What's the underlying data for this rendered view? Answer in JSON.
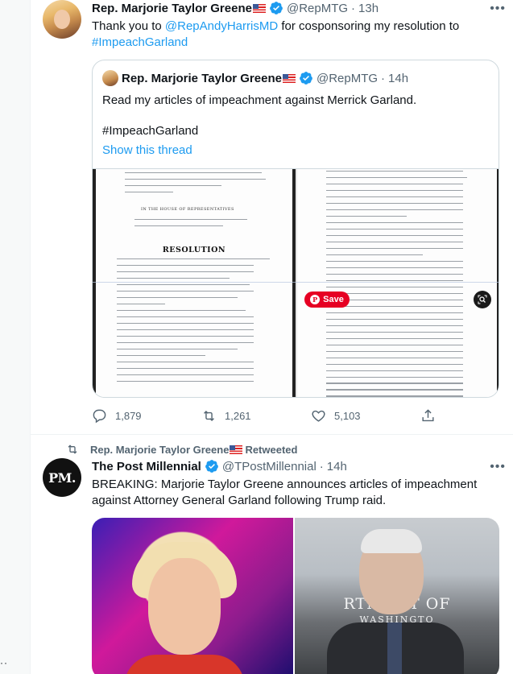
{
  "tweet1": {
    "author_name": "Rep. Marjorie Taylor Greene",
    "author_handle": "@RepMTG",
    "time": "13h",
    "text_prefix": "Thank you to ",
    "mention": "@RepAndyHarrisMD",
    "text_middle": " for cosponsoring my resolution to",
    "hashtag": "#ImpeachGarland",
    "quote": {
      "author_name": "Rep. Marjorie Taylor Greene",
      "author_handle": "@RepMTG",
      "time": "14h",
      "text": "Read my articles of impeachment against Merrick Garland.",
      "hashtag": "#ImpeachGarland",
      "show_thread": "Show this thread",
      "doc_heading": "IN THE HOUSE OF REPRESENTATIVES",
      "doc_title": "RESOLUTION",
      "save_label": "Save"
    },
    "actions": {
      "replies": "1,879",
      "retweets": "1,261",
      "likes": "5,103"
    }
  },
  "tweet2": {
    "retweeted_by": "Rep. Marjorie Taylor Greene",
    "retweeted_label": "Retweeted",
    "author_name": "The Post Millennial",
    "author_handle": "@TPostMillennial",
    "time": "14h",
    "avatar_text": "PM.",
    "text": "BREAKING: Marjorie Taylor Greene announces articles of impeachment against Attorney General Garland following Trump raid.",
    "image_sign_line1": "RTMENT OF",
    "image_sign_line2": "WASHINGTO"
  },
  "left_dots": "··",
  "colors": {
    "link": "#1d9bf0",
    "muted": "#536471",
    "text": "#0f1419",
    "save": "#e60023"
  }
}
